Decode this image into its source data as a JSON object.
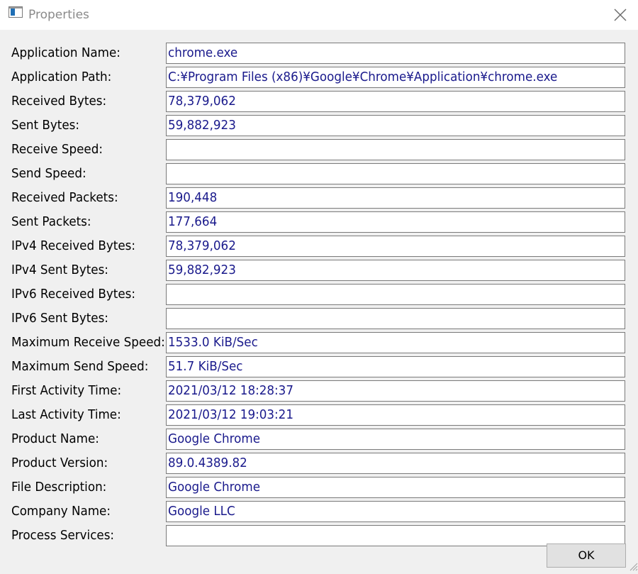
{
  "window": {
    "title": "Properties",
    "close_icon": "close-icon",
    "app_icon": "window-app-icon"
  },
  "fields": [
    {
      "label": "Application Name:",
      "value": "chrome.exe"
    },
    {
      "label": "Application Path:",
      "value": "C:¥Program Files (x86)¥Google¥Chrome¥Application¥chrome.exe"
    },
    {
      "label": "Received Bytes:",
      "value": "78,379,062"
    },
    {
      "label": "Sent Bytes:",
      "value": "59,882,923"
    },
    {
      "label": "Receive Speed:",
      "value": ""
    },
    {
      "label": "Send Speed:",
      "value": ""
    },
    {
      "label": "Received Packets:",
      "value": "190,448"
    },
    {
      "label": "Sent Packets:",
      "value": "177,664"
    },
    {
      "label": "IPv4 Received Bytes:",
      "value": "78,379,062"
    },
    {
      "label": "IPv4 Sent Bytes:",
      "value": "59,882,923"
    },
    {
      "label": "IPv6 Received Bytes:",
      "value": ""
    },
    {
      "label": "IPv6 Sent Bytes:",
      "value": ""
    },
    {
      "label": "Maximum Receive Speed:",
      "value": "1533.0 KiB/Sec"
    },
    {
      "label": "Maximum Send Speed:",
      "value": "51.7 KiB/Sec"
    },
    {
      "label": "First Activity Time:",
      "value": "2021/03/12 18:28:37"
    },
    {
      "label": "Last Activity Time:",
      "value": "2021/03/12 19:03:21"
    },
    {
      "label": "Product Name:",
      "value": "Google Chrome"
    },
    {
      "label": "Product Version:",
      "value": "89.0.4389.82"
    },
    {
      "label": "File Description:",
      "value": "Google Chrome"
    },
    {
      "label": "Company Name:",
      "value": "Google LLC"
    },
    {
      "label": "Process Services:",
      "value": ""
    }
  ],
  "buttons": {
    "ok_label": "OK"
  },
  "colors": {
    "value_text": "#1a1a8c",
    "background": "#f0f0f0"
  }
}
